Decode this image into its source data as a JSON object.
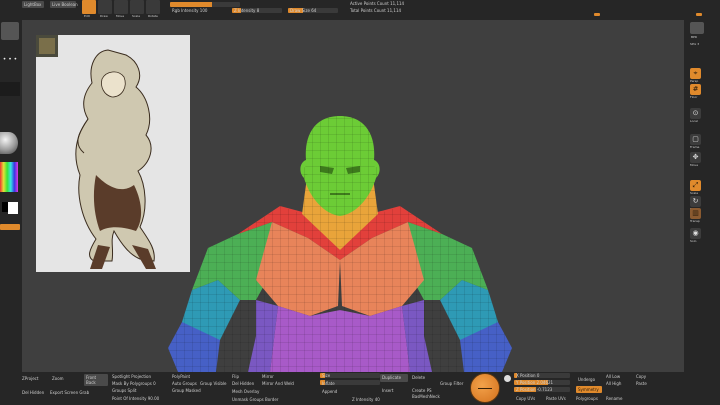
{
  "top_shelf": {
    "lightbox": "LightBox",
    "live_boolean": "Live Boolean",
    "mode_labels": [
      "Edit",
      "Draw",
      "Move",
      "Scale",
      "Rotate"
    ],
    "rgb_intensity": "Rgb Intensity 100",
    "z_intensity": "Z Intensity 8",
    "draw_size": "Draw Size 64",
    "active_points": "Active Points Count 11,114",
    "total_points": "Total Points Count 11,114"
  },
  "left_panel": {
    "spotlight_label": "Spotlight Projection",
    "lightbox_label": "LightBox"
  },
  "right_shelf": {
    "items": [
      "BPR",
      "SPix 3",
      "Persp",
      "Floor",
      "Local",
      "Frame",
      "Move",
      "Scale",
      "Rotate",
      "Transp",
      "Solo"
    ]
  },
  "bottom_tray": {
    "col1": [
      "ZProject",
      "Zoom",
      "Front",
      "Back",
      "Del Hidden",
      "Export Screen Grab"
    ],
    "col2": [
      "Spotlight Projection",
      "Mask By Polygroups 0",
      "Groups Split",
      "Point Of Intensity 90.00"
    ],
    "col3": [
      "PolyPaint",
      "Auto Groups",
      "Group Visible",
      "Group Masked",
      "Unmask Groups Border"
    ],
    "col4": [
      "Flip",
      "Del Hidden",
      "Mesh Overlay",
      "Mirror And Weld",
      "Mirror",
      "Append"
    ],
    "col5": [
      "Size",
      "Inflate",
      "Z Intensity 40"
    ],
    "col6": [
      "Duplicate",
      "Delete",
      "Insert",
      "Create PS",
      "BasMeshNeck",
      "Group Filter"
    ],
    "col7": [
      "X Position 0",
      "Y Position 2.04621",
      "Z Position -0.7123",
      "Copy UVs",
      "Paste UVs",
      "Polygroups"
    ],
    "col8": [
      "Undergo",
      "Symmetry",
      "All Low",
      "All High",
      "Copy",
      "Paste",
      "Rename"
    ]
  },
  "colors": {
    "accent": "#e08a2c",
    "ui_bg": "#2e2e2e",
    "viewport_bg": "#3f3f3f",
    "head": "#6ccc36",
    "neck": "#e9a43a",
    "traps": "#e2403b",
    "chest": "#e8845a",
    "abs": "#a85ac8",
    "arm_green": "#4caf55",
    "arm_cyan": "#2e9ab5",
    "arm_blue": "#4660c6"
  },
  "icons": {
    "dial": "circle-dial-icon",
    "material": "material-sphere-icon",
    "color": "color-picker-icon"
  }
}
